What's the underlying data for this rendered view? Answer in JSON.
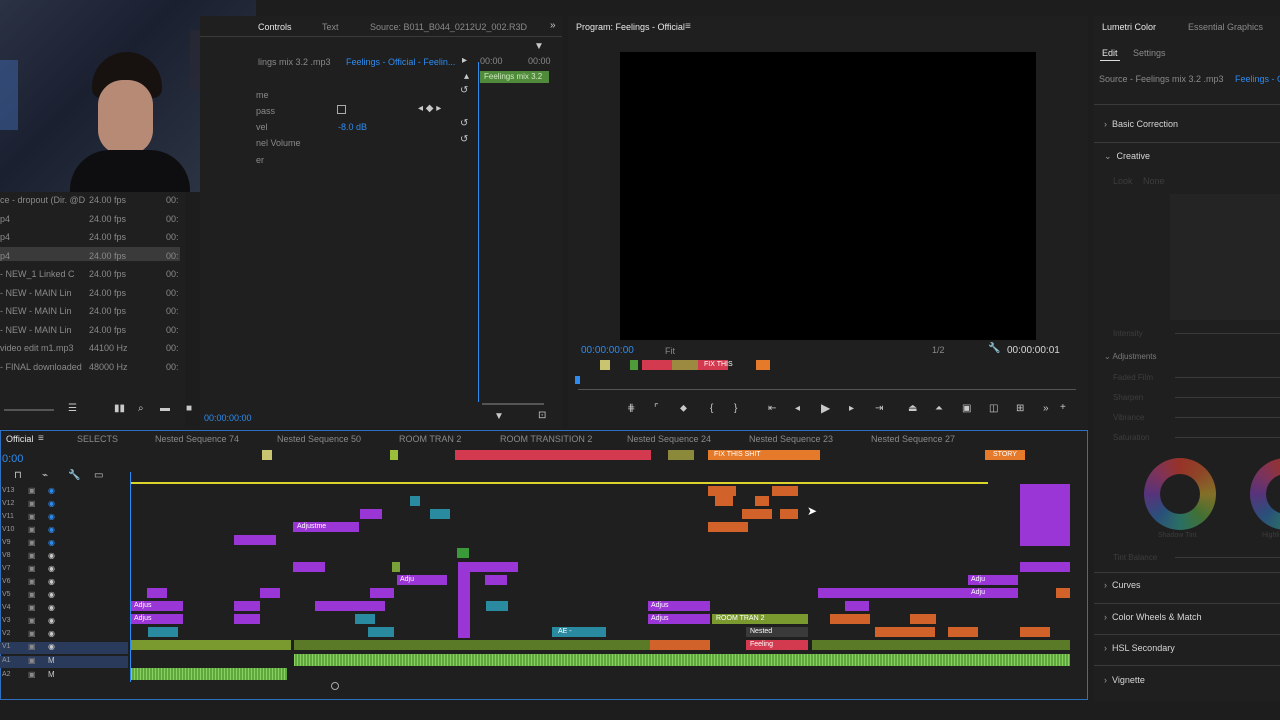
{
  "webcam": {
    "alt": "webcam overlay"
  },
  "project": {
    "rows": [
      {
        "name": "ce - dropout (Dir. @D",
        "rate": "24.00 fps",
        "dur": "00:"
      },
      {
        "name": "p4",
        "rate": "24.00 fps",
        "dur": "00:"
      },
      {
        "name": "p4",
        "rate": "24.00 fps",
        "dur": "00:"
      },
      {
        "name": "p4",
        "rate": "24.00 fps",
        "dur": "00:"
      },
      {
        "name": "- NEW_1 Linked C",
        "rate": "24.00 fps",
        "dur": "00:"
      },
      {
        "name": "- NEW - MAIN Lin",
        "rate": "24.00 fps",
        "dur": "00:"
      },
      {
        "name": "- NEW - MAIN Lin",
        "rate": "24.00 fps",
        "dur": "00:"
      },
      {
        "name": "- NEW - MAIN Lin",
        "rate": "24.00 fps",
        "dur": "00:"
      },
      {
        "name": "video edit m1.mp3",
        "rate": "44100 Hz",
        "dur": "00:"
      },
      {
        "name": "- FINAL downloaded",
        "rate": "48000 Hz",
        "dur": "00:"
      }
    ]
  },
  "effect_controls": {
    "tabs": [
      "Controls",
      "Text",
      "Source: B011_B044_0212U2_002.R3D"
    ],
    "source_label": "lings mix 3.2 .mp3",
    "sequence_label": "Feelings - Official - Feelin...",
    "tc_start": "00:00",
    "tc_end": "00:00",
    "clip_label": "Feelings mix 3.2",
    "props": [
      {
        "name": "me",
        "value": ""
      },
      {
        "name": "pass",
        "value": ""
      },
      {
        "name": "vel",
        "value": "-8.0 dB"
      },
      {
        "name": "nel Volume",
        "value": ""
      },
      {
        "name": "er",
        "value": ""
      }
    ],
    "timecode": "00:00:00:00"
  },
  "program": {
    "title": "Program: Feelings - Official",
    "timecode": "00:00:00:00",
    "fit": "Fit",
    "resolution": "1/2",
    "duration": "00:00:00:01",
    "markers": [
      "FIX THIS"
    ]
  },
  "lumetri": {
    "tabs": [
      "Lumetri Color",
      "Essential Graphics"
    ],
    "subtabs": [
      "Edit",
      "Settings"
    ],
    "source": "Source - Feelings mix 3.2 .mp3",
    "source_link": "Feelings - O",
    "sections": [
      "Basic Correction",
      "Creative",
      "Curves",
      "Color Wheels & Match",
      "HSL Secondary",
      "Vignette"
    ],
    "creative_look": "Look",
    "creative_look_value": "None",
    "intensity": "Intensity",
    "adjustments": "Adjustments",
    "adj_items": [
      "Faded Film",
      "Sharpen",
      "Vibrance",
      "Saturation"
    ],
    "shadow_tint": "Shadow Tint",
    "highlight_tint": "Highli",
    "tint_balance": "Tint Balance"
  },
  "timeline": {
    "tabs": [
      "Official",
      "SELECTS",
      "Nested Sequence 74",
      "Nested Sequence 50",
      "ROOM TRAN 2",
      "ROOM TRANSITION 2",
      "Nested Sequence 24",
      "Nested Sequence 23",
      "Nested Sequence 27"
    ],
    "timecode": "0:00",
    "markers": [
      "FIX THIS SHIT",
      "STORY"
    ],
    "tracks": [
      "V13",
      "V12",
      "V11",
      "V10",
      "V9",
      "V8",
      "V7",
      "V6",
      "V5",
      "V4",
      "V3",
      "V2",
      "V1",
      "A1",
      "A2"
    ],
    "clip_labels": [
      "Adjustme",
      "Adju",
      "Adjus",
      "Adjus",
      "Adjus",
      "Adjus",
      "Adju",
      "Adju",
      "Adju",
      "AE -",
      "ROOM TRAN 2",
      "Nested",
      "Feeling"
    ],
    "fx": "fx"
  }
}
